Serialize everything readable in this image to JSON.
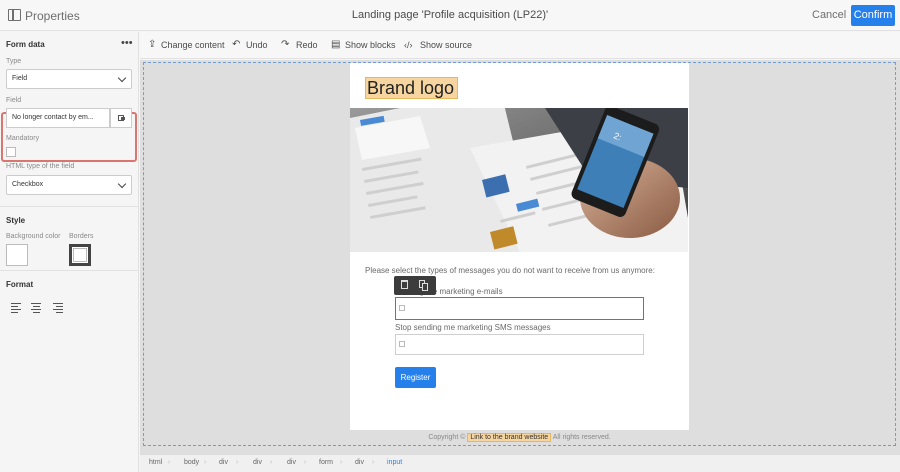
{
  "topbar": {
    "properties_label": "Properties",
    "page_title": "Landing page 'Profile acquisition (LP22)'",
    "cancel_label": "Cancel",
    "confirm_label": "Confirm"
  },
  "left_panel": {
    "form_data_heading": "Form data",
    "menu_icon": "ellipsis-icon",
    "type_label": "Type",
    "type_value": "Field",
    "field_label": "Field",
    "field_value": "No longer contact by em...",
    "mandatory_label": "Mandatory",
    "html_type_label": "HTML type of the field",
    "html_type_value": "Checkbox",
    "style_heading": "Style",
    "bg_color_label": "Background color",
    "borders_label": "Borders",
    "format_heading": "Format"
  },
  "toolbar": {
    "change_content": "Change content",
    "undo": "Undo",
    "redo": "Redo",
    "show_blocks": "Show blocks",
    "show_source": "Show source"
  },
  "page": {
    "brand_logo": "Brand logo",
    "intro_text": "Please select the types of messages you do not want to receive from us anymore:",
    "option1_label": "Stop sending me marketing e-mails",
    "option1_visible": "ng me marketing e-mails",
    "option2_label": "Stop sending me marketing SMS messages",
    "register_label": "Register",
    "footer_prefix": "Copyright ©",
    "footer_link": "Link to the brand website",
    "footer_suffix": "All rights reserved."
  },
  "breadcrumb": [
    "html",
    "body",
    "div",
    "div",
    "div",
    "form",
    "div",
    "input"
  ],
  "colors": {
    "accent": "#2680eb",
    "highlight_border": "#d9766f",
    "logo_highlight": "#f6d5a0"
  }
}
